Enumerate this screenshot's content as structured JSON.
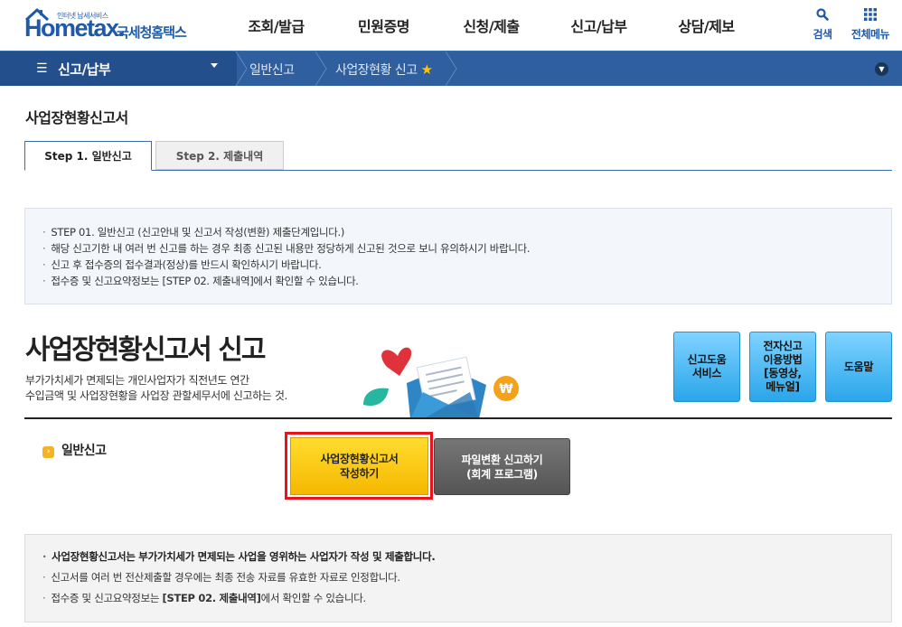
{
  "header": {
    "logo_tagline": "인터넷 납세서비스",
    "logo_wordmark": "Hometax.",
    "logo_korean": "국세청홈택스",
    "nav": [
      "조회/발급",
      "민원증명",
      "신청/제출",
      "신고/납부",
      "상담/제보"
    ],
    "search_label": "검색",
    "all_menu_label": "전체메뉴"
  },
  "location": {
    "current_menu": "신고/납부",
    "crumb1": "일반신고",
    "crumb2": "사업장현황 신고"
  },
  "page": {
    "title": "사업장현황신고서",
    "tabs": [
      "Step 1. 일반신고",
      "Step 2. 제출내역"
    ],
    "active_tab": 0
  },
  "guide": [
    "STEP 01. 일반신고 (신고안내 및 신고서 작성(변환) 제출단계입니다.)",
    "해당 신고기한 내 여러 번 신고를 하는 경우 최종 신고된 내용만 정당하게 신고된 것으로 보니 유의하시기 바랍니다.",
    "신고 후 접수증의 접수결과(정상)를 반드시 확인하시기 바랍니다.",
    "접수증 및 신고요약정보는 [STEP 02. 제출내역]에서 확인할 수 있습니다."
  ],
  "hero": {
    "title": "사업장현황신고서 신고",
    "desc_line1": "부가가치세가 면제되는 개인사업자가 직전년도 연간",
    "desc_line2": "수입금액 및 사업장현황을 사업장 관할세무서에 신고하는 것.",
    "help_buttons": [
      "신고도움\n서비스",
      "전자신고\n이용방법\n[동영상,\n메뉴얼]",
      "도움말"
    ]
  },
  "filing": {
    "section_label": "일반신고",
    "write_button": "사업장현황신고서\n작성하기",
    "convert_button": "파일변환 신고하기\n(회계 프로그램)"
  },
  "notice": {
    "line1": "사업장현황신고서는 부가가치세가 면제되는 사업을 영위하는 사업자가 작성 및 제출합니다.",
    "line2": "신고서를 여러 번 전산제출할 경우에는 최종 전송 자료를 유효한 자료로 인정합니다.",
    "line3_prefix": "접수증 및 신고요약정보는 ",
    "line3_bold": "[STEP 02. 제출내역]",
    "line3_suffix": "에서 확인할 수 있습니다."
  },
  "colors": {
    "brand_blue": "#1e5aa8",
    "location_bar": "#2f5f9f",
    "write_button": "#f5b800",
    "highlight_border": "#e8131d",
    "help_button": "#2aa5ea"
  }
}
